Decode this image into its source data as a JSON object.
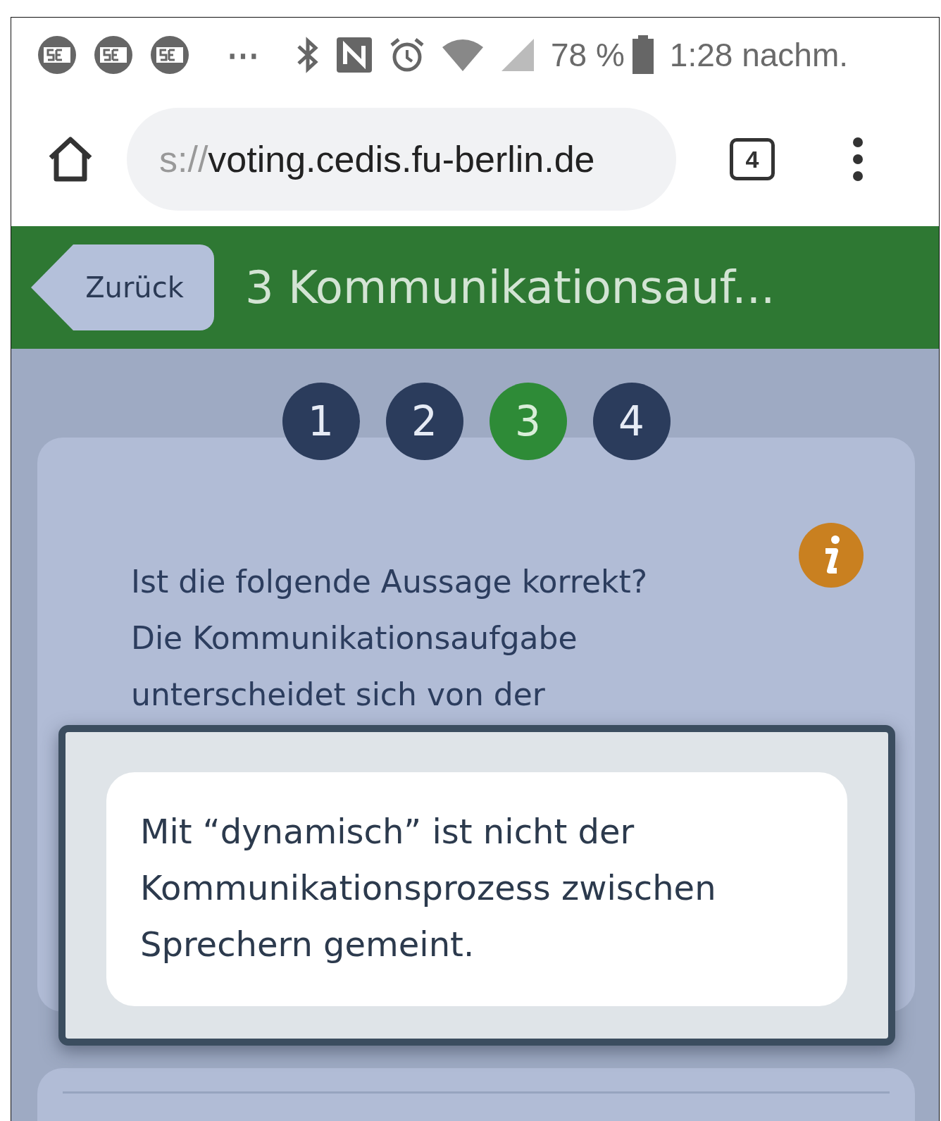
{
  "status_bar": {
    "overflow": "⋯",
    "battery": "78 %",
    "time": "1:28 nachm."
  },
  "browser": {
    "url_faded": "s://",
    "url": "voting.cedis.fu-berlin.de",
    "tab_count": "4"
  },
  "header": {
    "back": "Zurück",
    "title": "3 Kommunikationsauf..."
  },
  "steps": [
    {
      "label": "1",
      "selected": false
    },
    {
      "label": "2",
      "selected": false
    },
    {
      "label": "3",
      "selected": true
    },
    {
      "label": "4",
      "selected": false
    }
  ],
  "question": {
    "lines": [
      "Ist die folgende Aussage korrekt?",
      "Die Kommunikationsaufgabe",
      "unterscheidet sich von der"
    ]
  },
  "dialog": {
    "text": "Mit “dynamisch” ist nicht der Kommunikationsprozess zwischen Sprechern gemeint."
  }
}
